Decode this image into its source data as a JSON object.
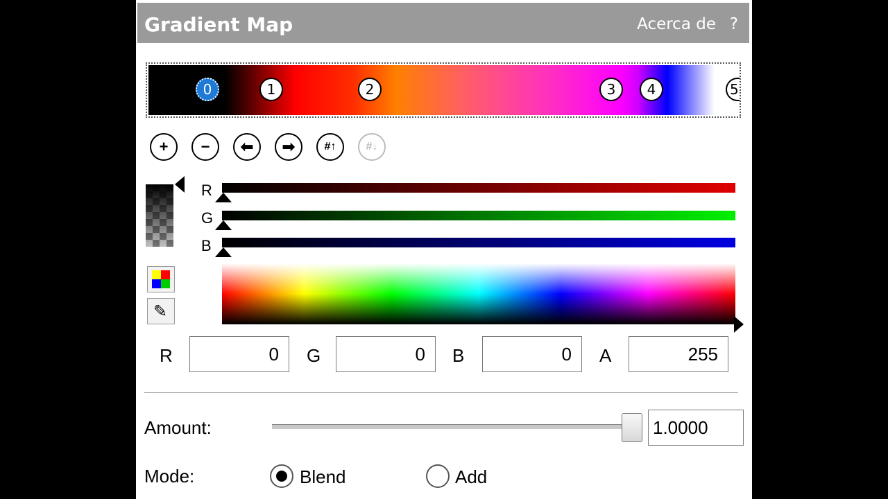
{
  "title": "Gradient Map",
  "header": {
    "about": "Acerca de",
    "help": "?"
  },
  "gradient": {
    "stops": [
      {
        "label": "0",
        "selected": true
      },
      {
        "label": "1",
        "selected": false
      },
      {
        "label": "2",
        "selected": false
      },
      {
        "label": "3",
        "selected": false
      },
      {
        "label": "4",
        "selected": false
      },
      {
        "label": "5",
        "selected": false
      }
    ]
  },
  "toolbar": {
    "add_icon": "plus-circle-icon",
    "remove_icon": "minus-circle-icon",
    "left_icon": "arrow-left-icon",
    "right_icon": "arrow-right-icon",
    "distribute_icon": "distribute-icon",
    "reverse_icon": "reverse-icon-disabled"
  },
  "channels": {
    "r": "R",
    "g": "G",
    "b": "B"
  },
  "fields": {
    "r_label": "R",
    "r_value": "0",
    "g_label": "G",
    "g_value": "0",
    "b_label": "B",
    "b_value": "0",
    "a_label": "A",
    "a_value": "255"
  },
  "amount": {
    "label": "Amount:",
    "value": "1.0000",
    "level": 1.0
  },
  "mode": {
    "label": "Mode:",
    "options": [
      {
        "label": "Blend",
        "checked": true
      },
      {
        "label": "Add",
        "checked": false
      }
    ]
  },
  "colors": {
    "titlebar": "#9a9a9a",
    "selected_stop": "#1e7ad6"
  }
}
